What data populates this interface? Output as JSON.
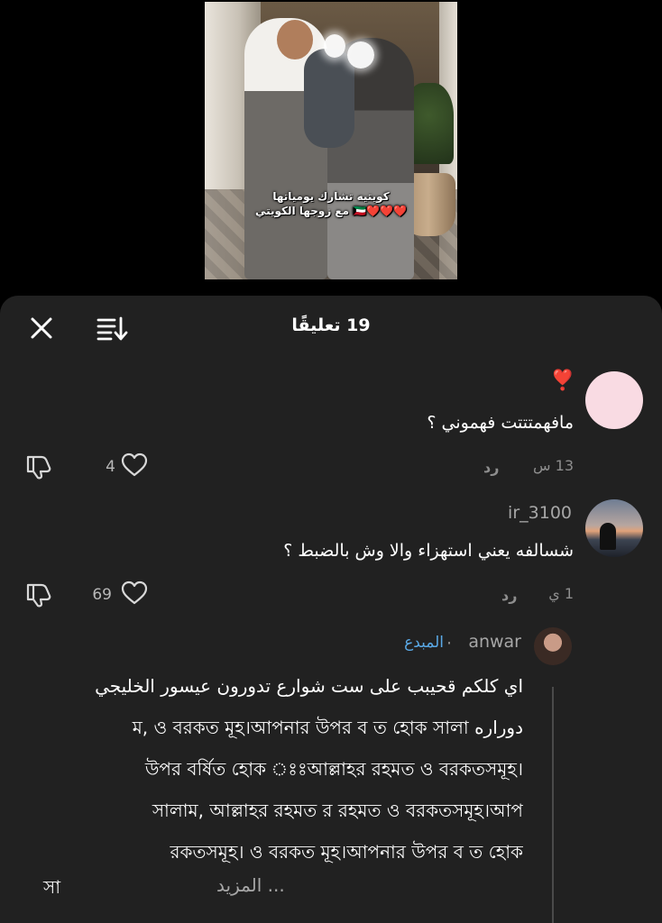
{
  "video": {
    "caption_line1": "كويتيه تشارك يومياتها",
    "caption_line2": "مع زوجها الكويتي 🇰🇼❤️❤️❤️"
  },
  "header": {
    "title": "19 تعليقًا"
  },
  "comments": [
    {
      "author": "",
      "emoji": "❣️",
      "text": "مافهمتتتت فهموني ؟",
      "time": "13 س",
      "reply_label": "رد",
      "likes": "4",
      "avatar_color": "#f9dbe3"
    },
    {
      "author": "ir_3100",
      "text": "شسالفه يعني استهزاء والا وش بالضبط ؟",
      "time": "1 ي",
      "reply_label": "رد",
      "likes": "69"
    },
    {
      "author": "anwar",
      "badge": "المبدع",
      "lines": [
        "اي كلكم قحيبب على ست شوارع تدورون عيسور الخليجي",
        "دوراره ম, ও বরকত মূহ।আপনার উপর ব ত হোক সালা",
        "উপর বর্ষিত হোক ঃঃআল্লাহর রহমত ও বরকতসমূহ।",
        "সালাম, আল্লাহর রহমত র রহমত ও বরকতসমূহ।আপ",
        "রকতসমূহ। ও বরকত মূহ।আপনার উপর ব ত হোক"
      ],
      "last_fragment": "সা",
      "more_label": "... المزيد"
    }
  ],
  "colors": {
    "sheet_bg": "#212121",
    "text_secondary": "#8e8e8e",
    "creator_badge": "#5aa9e6",
    "heart_red": "#e0245e"
  }
}
